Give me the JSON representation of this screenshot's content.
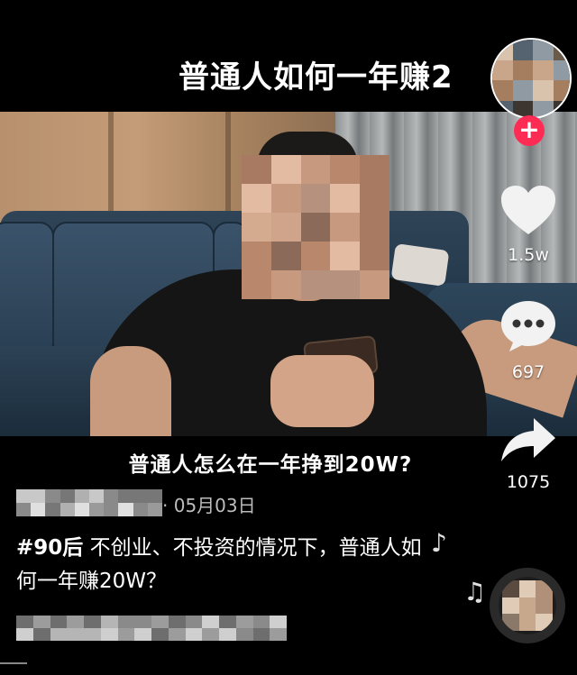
{
  "title_overlay": "普通人如何一年赚2",
  "video_caption": "普通人怎么在一年挣到20W?",
  "actions": {
    "like_count": "1.5w",
    "comment_count": "697",
    "share_count": "1075",
    "follow_symbol": "+"
  },
  "post": {
    "date": "· 05月03日",
    "hashtag": "#90后",
    "text": " 不创业、不投资的情况下，普通人如何一年赚20W？"
  },
  "icons": {
    "like": "heart-icon",
    "comment": "chat-bubble-icon",
    "share": "share-arrow-icon",
    "music": "music-note-icon"
  },
  "colors": {
    "background": "#000000",
    "follow": "#fe2c55",
    "text": "#ffffff",
    "muted": "#bdbdbd"
  }
}
